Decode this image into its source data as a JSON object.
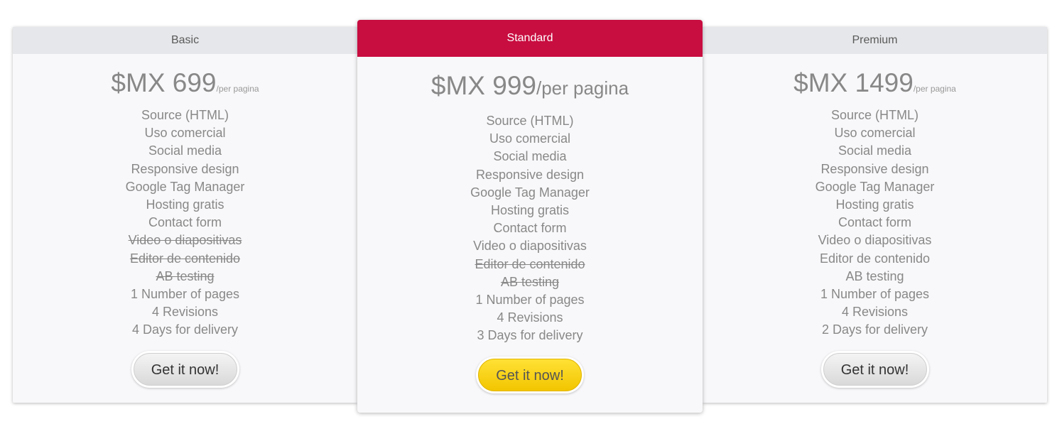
{
  "plans": [
    {
      "name": "Basic",
      "price": "$MX 699",
      "per": "/per pagina",
      "features": [
        {
          "text": "Source (HTML)",
          "included": true
        },
        {
          "text": "Uso comercial",
          "included": true
        },
        {
          "text": "Social media",
          "included": true
        },
        {
          "text": "Responsive design",
          "included": true
        },
        {
          "text": "Google Tag Manager",
          "included": true
        },
        {
          "text": "Hosting gratis",
          "included": true
        },
        {
          "text": "Contact form",
          "included": true
        },
        {
          "text": "Video o diapositivas",
          "included": false
        },
        {
          "text": "Editor de contenido",
          "included": false
        },
        {
          "text": "AB testing",
          "included": false
        },
        {
          "text": "1 Number of pages",
          "included": true
        },
        {
          "text": "4 Revisions",
          "included": true
        },
        {
          "text": "4 Days for delivery",
          "included": true
        }
      ],
      "cta": "Get it now!"
    },
    {
      "name": "Standard",
      "price": "$MX 999",
      "per": "/per pagina",
      "featured": true,
      "features": [
        {
          "text": "Source (HTML)",
          "included": true
        },
        {
          "text": "Uso comercial",
          "included": true
        },
        {
          "text": "Social media",
          "included": true
        },
        {
          "text": "Responsive design",
          "included": true
        },
        {
          "text": "Google Tag Manager",
          "included": true
        },
        {
          "text": "Hosting gratis",
          "included": true
        },
        {
          "text": "Contact form",
          "included": true
        },
        {
          "text": "Video o diapositivas",
          "included": true
        },
        {
          "text": "Editor de contenido",
          "included": false
        },
        {
          "text": "AB testing",
          "included": false
        },
        {
          "text": "1 Number of pages",
          "included": true
        },
        {
          "text": "4 Revisions",
          "included": true
        },
        {
          "text": "3 Days for delivery",
          "included": true
        }
      ],
      "cta": "Get it now!"
    },
    {
      "name": "Premium",
      "price": "$MX 1499",
      "per": "/per pagina",
      "features": [
        {
          "text": "Source (HTML)",
          "included": true
        },
        {
          "text": "Uso comercial",
          "included": true
        },
        {
          "text": "Social media",
          "included": true
        },
        {
          "text": "Responsive design",
          "included": true
        },
        {
          "text": "Google Tag Manager",
          "included": true
        },
        {
          "text": "Hosting gratis",
          "included": true
        },
        {
          "text": "Contact form",
          "included": true
        },
        {
          "text": "Video o diapositivas",
          "included": true
        },
        {
          "text": "Editor de contenido",
          "included": true
        },
        {
          "text": "AB testing",
          "included": true
        },
        {
          "text": "1 Number of pages",
          "included": true
        },
        {
          "text": "4 Revisions",
          "included": true
        },
        {
          "text": "2 Days for delivery",
          "included": true
        }
      ],
      "cta": "Get it now!"
    }
  ],
  "colors": {
    "featured_header": "#c80d40",
    "featured_button": "#ffd60a",
    "header_bg": "#e6e7ea",
    "card_bg": "#f8f8fa",
    "text": "#888888"
  }
}
